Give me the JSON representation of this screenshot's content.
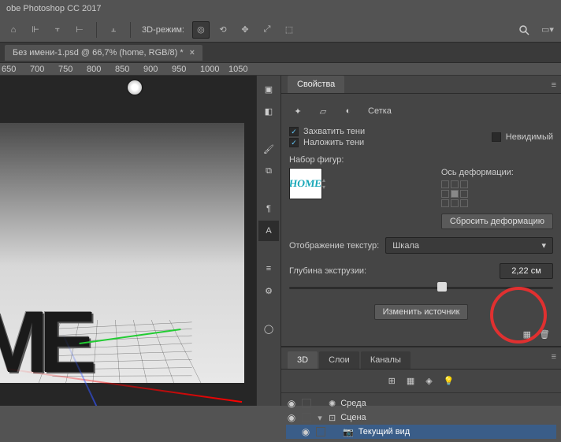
{
  "app": {
    "title": "obe Photoshop CC 2017"
  },
  "toolbar": {
    "mode_label": "3D-режим:"
  },
  "document": {
    "tab_title": "Без имени-1.psd @ 66,7% (home, RGB/8) *"
  },
  "ruler": {
    "marks": [
      "650",
      "700",
      "750",
      "800",
      "850",
      "900",
      "950",
      "1000",
      "1050"
    ]
  },
  "properties": {
    "panel_title": "Свойства",
    "grid_label": "Сетка",
    "capture_shadows": "Захватить тени",
    "overlay_shadows": "Наложить тени",
    "invisible": "Невидимый",
    "shape_set": "Набор фигур:",
    "thumb_text": "HOME",
    "deform_axis": "Ось деформации:",
    "reset_deform": "Сбросить деформацию",
    "texture_display": "Отображение текстур:",
    "texture_value": "Шкала",
    "extrusion_depth": "Глубина экструзии:",
    "extrusion_value": "2,22 см",
    "change_source": "Изменить источник"
  },
  "panel3d": {
    "tabs": [
      "3D",
      "Слои",
      "Каналы"
    ],
    "tree": {
      "env": "Среда",
      "scene": "Сцена",
      "view": "Текущий вид"
    }
  }
}
